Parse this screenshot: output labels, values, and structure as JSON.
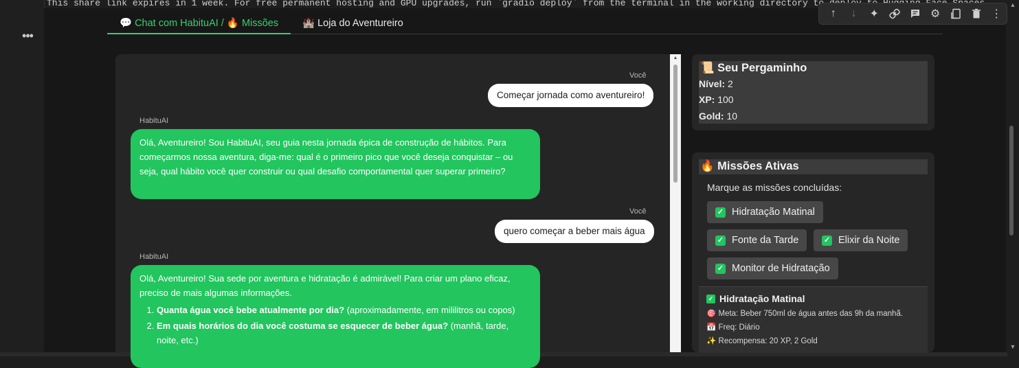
{
  "top_output_text": "This share link expires in 1 week. For free permanent hosting and GPU upgrades, run `gradio deploy` from the terminal in the working directory to deploy to Hugging Face Spaces",
  "more_label": "•••",
  "cell_toolbar": {
    "icons": [
      "arrow-up-icon",
      "arrow-down-icon",
      "sparkle-icon",
      "link-icon",
      "comment-icon",
      "gear-icon",
      "mirror-cell-icon",
      "trash-icon",
      "more-vertical-icon"
    ],
    "glyphs": {
      "up": "↑",
      "down": "↓",
      "sparkle": "✦",
      "link": "⊂⊃",
      "comment": "▤",
      "gear": "⚙",
      "mirror": "⧉",
      "trash": "🗑",
      "more": "⋮"
    }
  },
  "tabs": [
    {
      "label": "💬 Chat com HabituAI / 🔥 Missões",
      "active": true
    },
    {
      "label": "🏰 Loja do Aventureiro",
      "active": false
    }
  ],
  "chat": {
    "messages": [
      {
        "sender": "Você",
        "role": "user",
        "text": "Começar jornada como aventureiro!"
      },
      {
        "sender": "HabituAI",
        "role": "bot",
        "text": "Olá, Aventureiro! Sou HabituAI, seu guia nesta jornada épica de construção de hábitos. Para começarmos nossa aventura, diga-me: qual é o primeiro pico que você deseja conquistar – ou seja, qual hábito você quer construir ou qual desafio comportamental quer superar primeiro?"
      },
      {
        "sender": "Você",
        "role": "user",
        "text": "quero começar a beber mais água"
      },
      {
        "sender": "HabituAI",
        "role": "bot",
        "text": "Olá, Aventureiro! Sua sede por aventura e hidratação é admirável! Para criar um plano eficaz, preciso de mais algumas informações.",
        "list": [
          {
            "bold": "Quanta água você bebe atualmente por dia?",
            "rest": " (aproximadamente, em mililitros ou copos)"
          },
          {
            "bold": "Em quais horários do dia você costuma se esquecer de beber água?",
            "rest": " (manhã, tarde, noite, etc.)"
          }
        ]
      }
    ]
  },
  "scroll": {
    "up": "▲",
    "down": "▼"
  },
  "pergaminho": {
    "title": "📜 Seu Pergaminho",
    "nivel_label": "Nível:",
    "nivel_value": "2",
    "xp_label": "XP:",
    "xp_value": "100",
    "gold_label": "Gold:",
    "gold_value": "10"
  },
  "missoes": {
    "title": "🔥 Missões Ativas",
    "hint": "Marque as missões concluídas:",
    "check_mark": "✓",
    "items": [
      {
        "label": "Hidratação Matinal",
        "checked": true
      },
      {
        "label": "Fonte da Tarde",
        "checked": true
      },
      {
        "label": "Elixir da Noite",
        "checked": true
      },
      {
        "label": "Monitor de Hidratação",
        "checked": true
      }
    ],
    "detail": {
      "title": "Hidratação Matinal",
      "meta": "🎯 Meta: Beber 750ml de água antes das 9h da manhã.",
      "freq": "📅 Freq: Diário",
      "reward": "✨ Recompensa: 20 XP, 2 Gold"
    }
  }
}
